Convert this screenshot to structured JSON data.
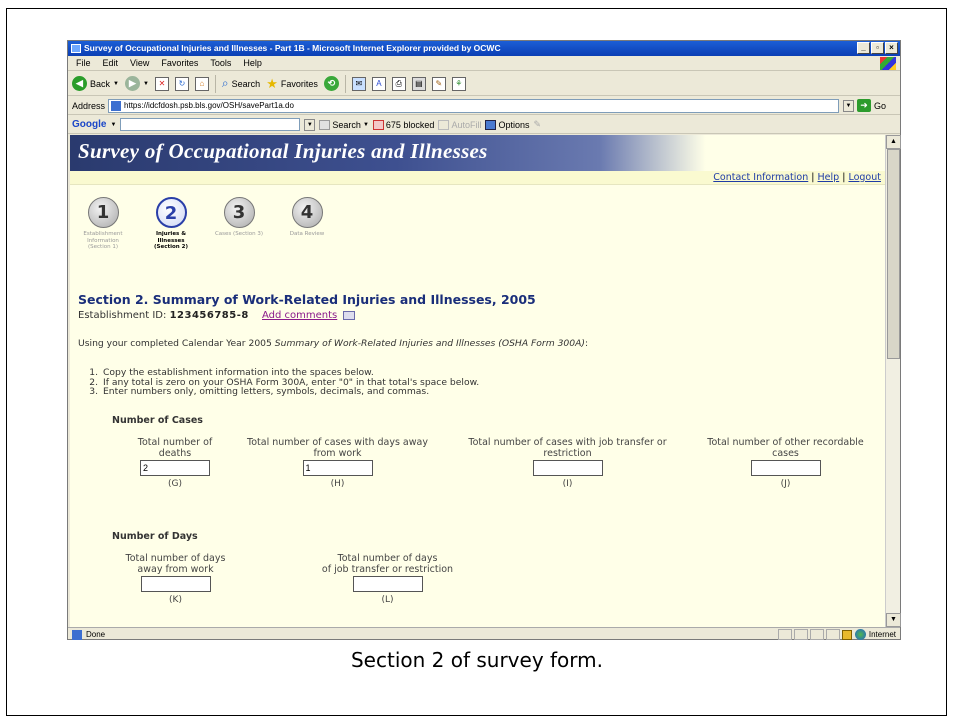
{
  "browser": {
    "title": "Survey of Occupational Injuries and Illnesses - Part 1B - Microsoft Internet Explorer provided by OCWC",
    "menu": [
      "File",
      "Edit",
      "View",
      "Favorites",
      "Tools",
      "Help"
    ],
    "toolbar": {
      "back": "Back",
      "search": "Search",
      "favorites": "Favorites"
    },
    "address_label": "Address",
    "address_url": "https://idcfdosh.psb.bls.gov/OSH/savePart1a.do",
    "go_label": "Go",
    "google": {
      "logo": "Google",
      "search": "Search",
      "blocked": "675 blocked",
      "autofill": "AutoFill",
      "options": "Options"
    },
    "status": {
      "text": "Done",
      "zone": "Internet"
    }
  },
  "page": {
    "banner_title": "Survey of Occupational Injuries and Illnesses",
    "links": {
      "contact": "Contact Information",
      "help": "Help",
      "logout": "Logout",
      "sep": "|"
    },
    "steps": [
      {
        "num": "1",
        "label": "Establishment Information (Section 1)",
        "active": false
      },
      {
        "num": "2",
        "label": "Injuries & Illnesses (Section 2)",
        "active": true
      },
      {
        "num": "3",
        "label": "Cases (Section 3)",
        "active": false
      },
      {
        "num": "4",
        "label": "Data Review",
        "active": false
      }
    ],
    "section_title": "Section 2. Summary of Work-Related Injuries and Illnesses, 2005",
    "establishment_label": "Establishment ID:",
    "establishment_id": "123456785-8",
    "add_comments": "Add comments",
    "intro_prefix": "Using your completed Calendar Year 2005 ",
    "intro_italic": "Summary of Work-Related Injuries and Illnesses (OSHA Form 300A)",
    "intro_suffix": ":",
    "instructions": [
      {
        "n": "1.",
        "text": "Copy the establishment information into the spaces below."
      },
      {
        "n": "2.",
        "text": "If any total is zero on your OSHA Form 300A, enter \"0\" in that total's space below."
      },
      {
        "n": "3.",
        "text": "Enter numbers only, omitting letters, symbols, decimals, and commas."
      }
    ],
    "cases_heading": "Number of Cases",
    "cases": [
      {
        "label1": "Total number of",
        "label2": "deaths",
        "value": "2",
        "code": "(G)"
      },
      {
        "label1": "Total number of cases with days away",
        "label2": "from work",
        "value": "1",
        "code": "(H)"
      },
      {
        "label1": "Total number of cases with job transfer or",
        "label2": "restriction",
        "value": "",
        "code": "(I)"
      },
      {
        "label1": "Total number of other recordable",
        "label2": "cases",
        "value": "",
        "code": "(J)"
      }
    ],
    "days_heading": "Number of Days",
    "days": [
      {
        "label1": "Total number of days",
        "label2": "away from work",
        "value": "",
        "code": "(K)"
      },
      {
        "label1": "Total number of days",
        "label2": "of job transfer or restriction",
        "value": "",
        "code": "(L)"
      }
    ]
  },
  "caption": "Section 2 of survey form."
}
